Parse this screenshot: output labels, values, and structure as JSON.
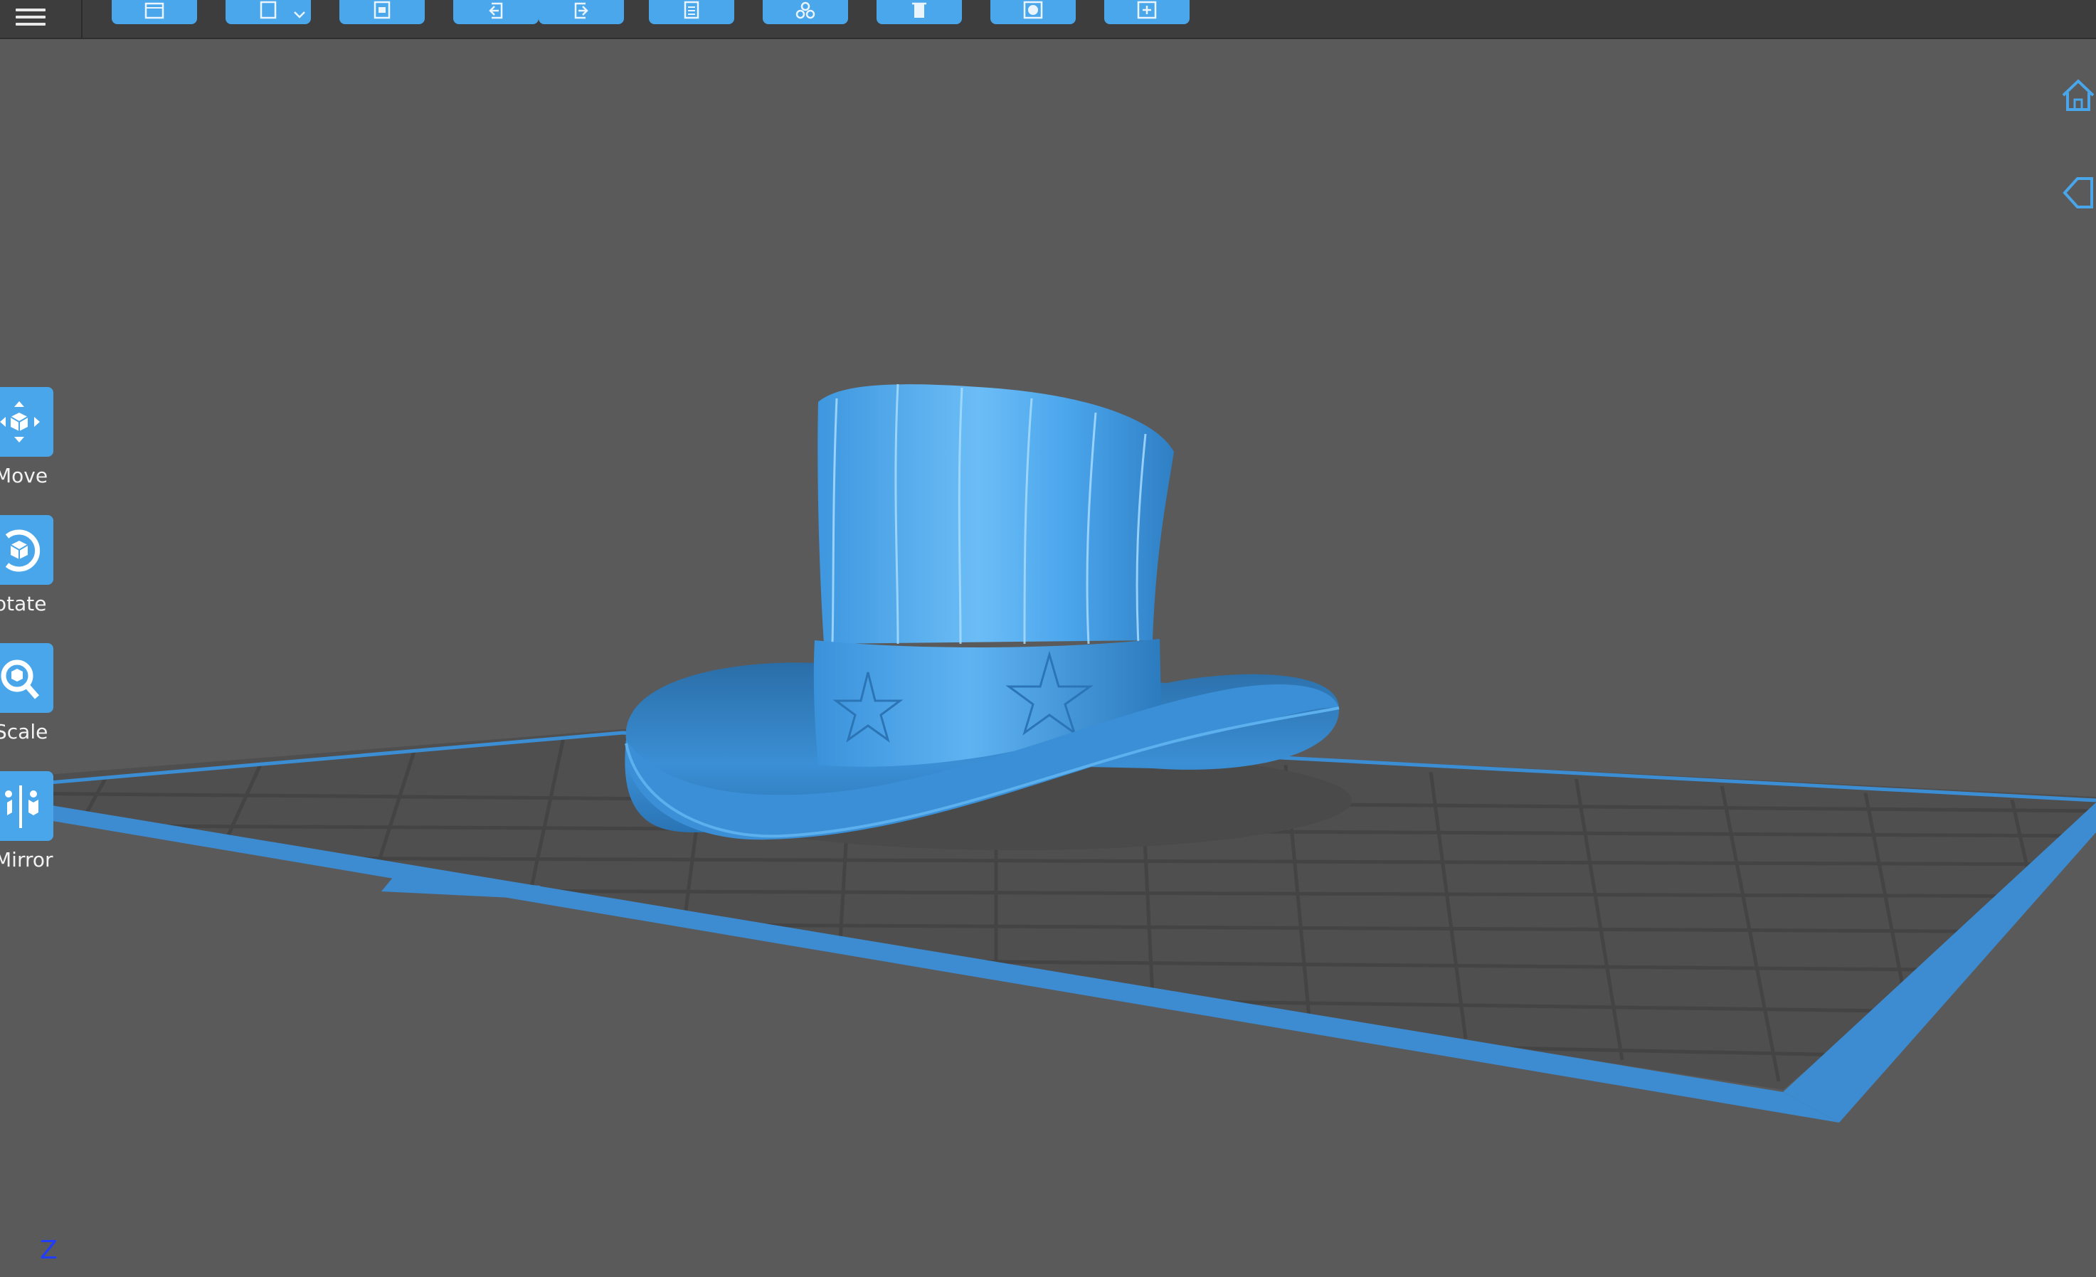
{
  "toolbar": {
    "buttons": [
      {
        "name": "open-file-icon"
      },
      {
        "name": "save-icon"
      },
      {
        "name": "import-icon"
      },
      {
        "name": "undo-icon"
      },
      {
        "name": "redo-icon"
      },
      {
        "name": "list-icon"
      },
      {
        "name": "arrange-icon"
      },
      {
        "name": "delete-icon"
      },
      {
        "name": "view-icon"
      },
      {
        "name": "add-icon"
      }
    ]
  },
  "tools": {
    "move": {
      "label": "Move",
      "icon": "move-icon"
    },
    "rotate": {
      "label": "otate",
      "icon": "rotate-icon"
    },
    "scale": {
      "label": "Scale",
      "icon": "scale-icon"
    },
    "mirror": {
      "label": "Mirror",
      "icon": "mirror-icon"
    }
  },
  "view": {
    "home_icon": "home-icon",
    "left_view_icon": "left-view-icon",
    "axis_label": "Z"
  },
  "colors": {
    "accent": "#4ba7ec",
    "model": "#3a8fd6",
    "background": "#5a5a5a",
    "toolbar": "#3d3d3d"
  }
}
